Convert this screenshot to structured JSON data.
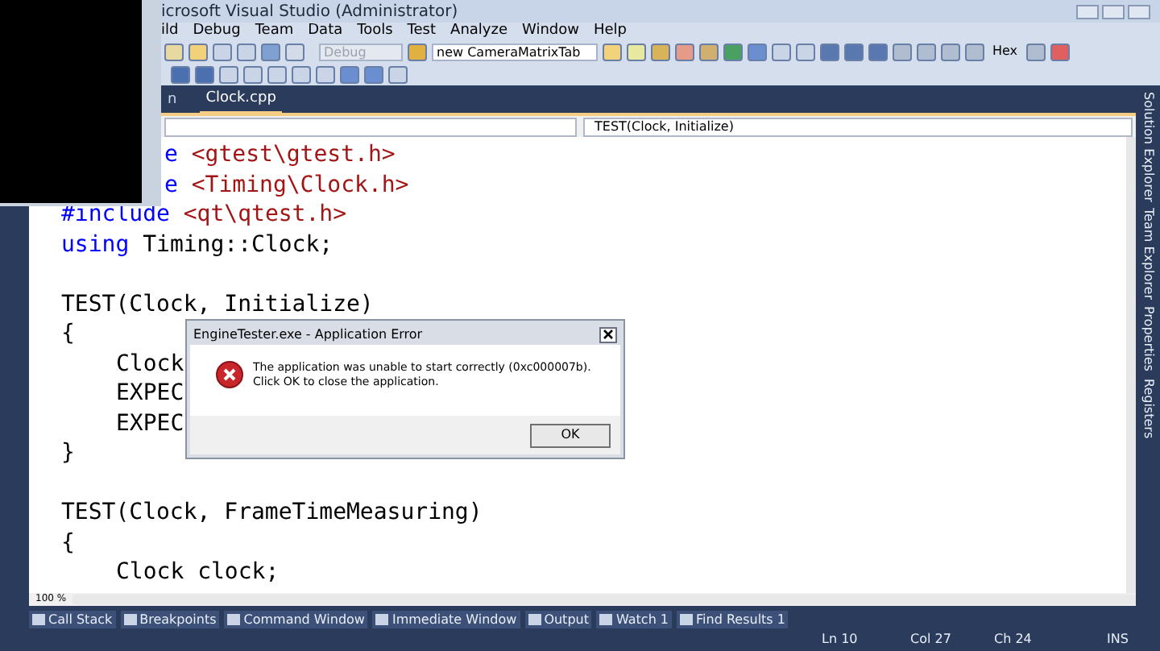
{
  "window": {
    "title": "icrosoft Visual Studio (Administrator)"
  },
  "menu": [
    "ild",
    "Debug",
    "Team",
    "Data",
    "Tools",
    "Test",
    "Analyze",
    "Window",
    "Help"
  ],
  "toolbar": {
    "configuration": {
      "value": "Debug",
      "disabled": true
    },
    "startup": {
      "value": "new CameraMatrixTab"
    },
    "hex": "Hex"
  },
  "tabs": [
    {
      "label": "n",
      "selected": false
    },
    {
      "label": "Clock.cpp",
      "selected": true
    }
  ],
  "navigation": {
    "member": "TEST(Clock, Initialize)"
  },
  "code_lines": [
    {
      "kind": "partial",
      "tokens": [
        {
          "kind": "keyword",
          "text": "e"
        },
        {
          "kind": "string",
          "text": " <gtest\\gtest.h>"
        }
      ]
    },
    {
      "kind": "partial",
      "tokens": [
        {
          "kind": "keyword",
          "text": "e"
        },
        {
          "kind": "string",
          "text": " <Timing\\Clock.h>"
        }
      ]
    },
    {
      "kind": "plain",
      "tokens": [
        {
          "kind": "keyword",
          "text": "#include"
        },
        {
          "kind": "string",
          "text": " <qt\\qtest.h>"
        }
      ]
    },
    {
      "kind": "plain",
      "tokens": [
        {
          "kind": "keyword",
          "text": "using"
        },
        {
          "kind": "plain",
          "text": " Timing::Clock;"
        }
      ]
    },
    {
      "kind": "plain",
      "gap_before": true,
      "tokens": [
        {
          "kind": "plain",
          "text": "TEST(Clock, Initialize)"
        }
      ]
    },
    {
      "kind": "plain",
      "tokens": [
        {
          "kind": "plain",
          "text": "{"
        }
      ]
    },
    {
      "kind": "indented",
      "tokens": [
        {
          "kind": "plain",
          "text": "Clock"
        }
      ]
    },
    {
      "kind": "indented",
      "tokens": [
        {
          "kind": "plain",
          "text": "EXPEC"
        }
      ]
    },
    {
      "kind": "indented",
      "tokens": [
        {
          "kind": "plain",
          "text": "EXPEC"
        }
      ]
    },
    {
      "kind": "plain",
      "tokens": [
        {
          "kind": "plain",
          "text": "}"
        }
      ]
    },
    {
      "kind": "plain",
      "gap_before": true,
      "tokens": [
        {
          "kind": "plain",
          "text": "TEST(Clock, FrameTimeMeasuring)"
        }
      ]
    },
    {
      "kind": "plain",
      "tokens": [
        {
          "kind": "plain",
          "text": "{"
        }
      ]
    },
    {
      "kind": "indented",
      "tokens": [
        {
          "kind": "plain",
          "text": "Clock clock;"
        }
      ]
    }
  ],
  "zoom": "100 %",
  "dialog": {
    "title": "EngineTester.exe - Application Error",
    "message": "The application was unable to start correctly (0xc000007b). Click OK to close the application.",
    "button": "OK"
  },
  "bottom_tabs": [
    "Call Stack",
    "Breakpoints",
    "Command Window",
    "Immediate Window",
    "Output",
    "Watch 1",
    "Find Results 1"
  ],
  "status_bar": {
    "line": "Ln 10",
    "column": "Col 27",
    "char": "Ch 24",
    "mode": "INS"
  },
  "side_tabs": [
    "Solution Explorer",
    "Team Explorer",
    "Properties",
    "Registers"
  ]
}
